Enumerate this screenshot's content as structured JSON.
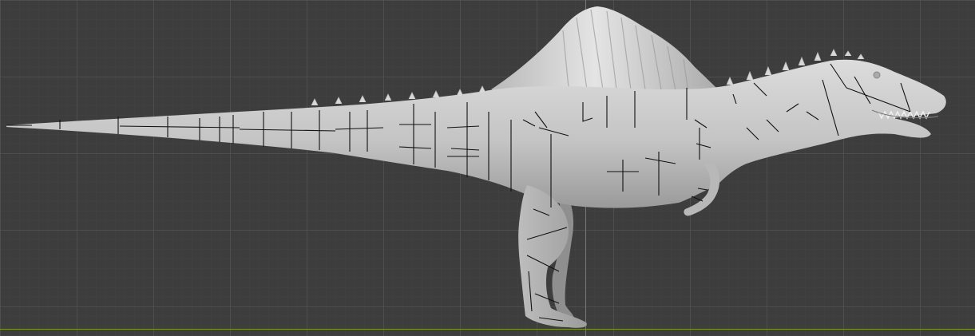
{
  "viewport": {
    "view_name": "",
    "grid_visible": true,
    "colors": {
      "background": "#3d3d3d",
      "grid": "#5a5a5a",
      "axis_z": "#5878b8",
      "axis_y": "#7a9a2a",
      "mesh": "#c9c9c9",
      "seams": "#111111"
    }
  },
  "model": {
    "object": "spinosaurus-mesh"
  }
}
